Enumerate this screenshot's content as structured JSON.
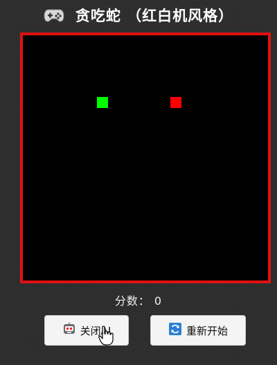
{
  "header": {
    "icon": "gamepad-icon",
    "title": "贪吃蛇 （红白机风格）"
  },
  "game": {
    "score_label": "分数：",
    "score_value": "0",
    "snake_color": "#00ff00",
    "food_color": "#ff0000",
    "border_color": "#e01010"
  },
  "controls": {
    "toggle_ai_icon": "robot-icon",
    "toggle_ai_label": "关闭AI",
    "restart_icon": "refresh-icon",
    "restart_label": "重新开始"
  }
}
